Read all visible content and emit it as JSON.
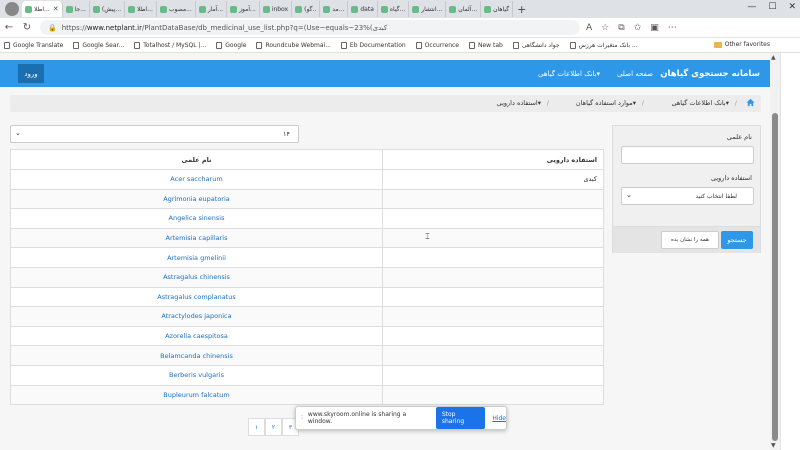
{
  "browser": {
    "tabs": [
      "اطلا...",
      "جا...",
      "(پیش...",
      "اطلا...",
      "مصوب...",
      "آمار...",
      "آموز...",
      "inbox",
      "(گو..",
      "مد...",
      "data",
      "گیاه...",
      "انتشار...",
      "آلمان...",
      "گیاهان"
    ],
    "url_prefix": "https://",
    "url_host": "www.netplant.ir",
    "url_path": "/PlantDataBase/db_medicinal_use_list.php?q=(Use~equals~23%(کبدی",
    "bookmarks": [
      "Google Translate",
      "Google Sear...",
      "Totalhost / MySQL |...",
      "Google",
      "Roundcube Webmai...",
      "Eb Documentation",
      "Occurrence",
      "New tab",
      "جواد دانشگاهی",
      "بانک متغیرات هرزس ..."
    ],
    "other_favorites": "Other favorites"
  },
  "navbar": {
    "brand": "سامانه جستجوی گیاهان",
    "home": "صفحه اصلی",
    "plant_bank": "بانک اطلاعات گیاهی",
    "login": "ورود"
  },
  "breadcrumb": [
    "بانک اطلاعات گیاهی",
    "موارد استفاده گیاهان",
    "استفاده دارویی"
  ],
  "search": {
    "sci_label": "نام علمی",
    "use_label": "استفاده دارویی",
    "select_placeholder": "لطفا انتخاب کنید",
    "search_button": "جستجو",
    "show_all_button": "همه را نشان بده"
  },
  "page_size": "۱۴",
  "table": {
    "headers": [
      "نام علمی",
      "استفاده دارویی"
    ],
    "rows": [
      [
        "Acer saccharum",
        "کبدی"
      ],
      [
        "Agrimonia eupatoria",
        ""
      ],
      [
        "Angelica sinensis",
        ""
      ],
      [
        "Artemisia capillaris",
        ""
      ],
      [
        "Artemisia gmelinii",
        ""
      ],
      [
        "Astragalus chinensis",
        ""
      ],
      [
        "Astragalus complanatus",
        ""
      ],
      [
        "Atractylodes japonica",
        ""
      ],
      [
        "Azorella caespitosa",
        ""
      ],
      [
        "Belamcanda chinensis",
        ""
      ],
      [
        "Berberis vulgaris",
        ""
      ],
      [
        "Bupleurum falcatum",
        ""
      ]
    ]
  },
  "pager": [
    "۱",
    "۲",
    "۳"
  ],
  "share": {
    "message": "www.skyroom.online is sharing a window.",
    "stop": "Stop sharing",
    "hide": "Hide"
  }
}
